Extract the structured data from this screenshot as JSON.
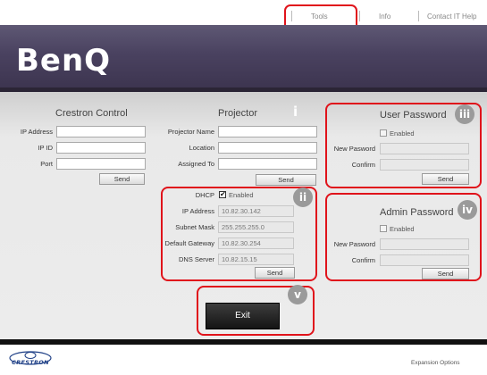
{
  "topnav": {
    "tools": "Tools",
    "info": "Info",
    "contact": "Contact IT Help"
  },
  "banner": {
    "logo": "BenQ"
  },
  "crestron": {
    "title": "Crestron Control",
    "ip_address_label": "IP Address",
    "ip_id_label": "IP ID",
    "port_label": "Port",
    "send": "Send"
  },
  "projector": {
    "title": "Projector",
    "name_label": "Projector Name",
    "location_label": "Location",
    "assigned_label": "Assigned To",
    "send": "Send"
  },
  "network": {
    "dhcp_label": "DHCP",
    "dhcp_checked": true,
    "enabled_label": "Enabled",
    "ip_label": "IP Address",
    "ip_value": "10.82.30.142",
    "subnet_label": "Subnet Mask",
    "subnet_value": "255.255.255.0",
    "gateway_label": "Default Gateway",
    "gateway_value": "10.82.30.254",
    "dns_label": "DNS Server",
    "dns_value": "10.82.15.15",
    "send": "Send"
  },
  "user_password": {
    "title": "User Password",
    "enabled_label": "Enabled",
    "new_label": "New Pasword",
    "confirm_label": "Confirm",
    "send": "Send"
  },
  "admin_password": {
    "title": "Admin Password",
    "enabled_label": "Enabled",
    "new_label": "New Pasword",
    "confirm_label": "Confirm",
    "send": "Send"
  },
  "exit": {
    "label": "Exit"
  },
  "markers": {
    "i": "i",
    "ii": "ii",
    "iii": "iii",
    "iv": "iv",
    "v": "v"
  },
  "footer": {
    "brand": "CRESTRON",
    "right": "Expansion Options"
  },
  "colors": {
    "highlight": "#e0131b",
    "banner": "#4a4260",
    "link_blue": "#1e3f86"
  }
}
